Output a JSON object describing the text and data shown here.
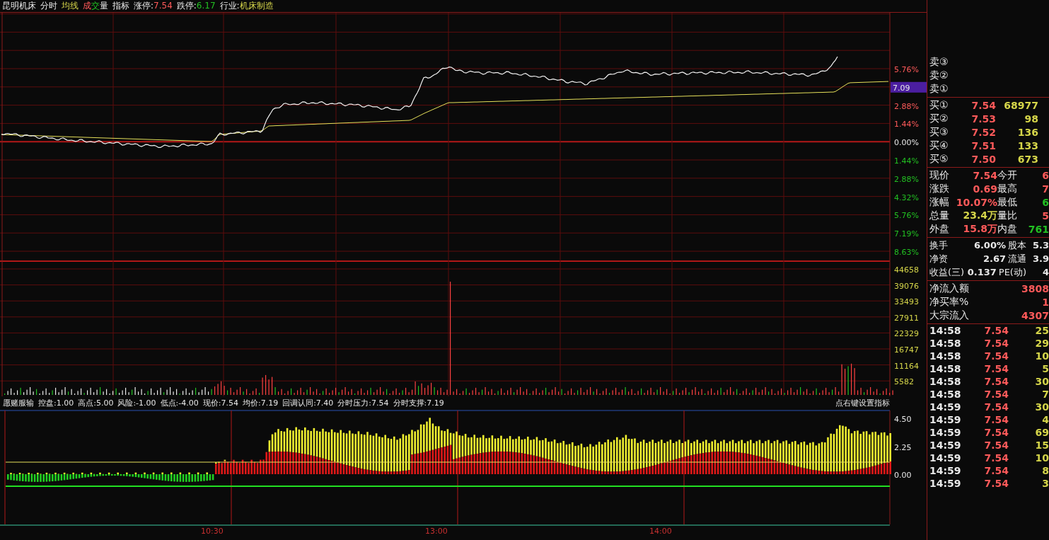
{
  "top_bar": [
    {
      "segments": [
        {
          "text": "昆明机床",
          "kind": "plain"
        }
      ]
    },
    {
      "segments": [
        {
          "text": "分时",
          "kind": "plain"
        }
      ]
    },
    {
      "segments": [
        {
          "text": "均线",
          "kind": "vol"
        }
      ]
    },
    {
      "segments": [
        {
          "text": "成",
          "kind": "up"
        },
        {
          "text": "交",
          "kind": "down"
        },
        {
          "text": "量",
          "kind": "plain"
        }
      ]
    },
    {
      "segments": [
        {
          "text": "指标",
          "kind": "plain"
        }
      ]
    },
    {
      "segments": [
        {
          "text": "涨停:",
          "kind": "plain"
        },
        {
          "text": "7.54",
          "kind": "up"
        }
      ]
    },
    {
      "segments": [
        {
          "text": "跌停:",
          "kind": "plain"
        },
        {
          "text": "6.17",
          "kind": "down"
        }
      ]
    },
    {
      "segments": [
        {
          "text": "行业:",
          "kind": "plain"
        },
        {
          "text": "机床制造",
          "kind": "vol"
        }
      ]
    }
  ],
  "price_axis": [
    {
      "label": "5.76%",
      "kind": "up"
    },
    {
      "kind": "tag"
    },
    {
      "label": "2.88%",
      "kind": "up"
    },
    {
      "label": "1.44%",
      "kind": "up"
    },
    {
      "label": "0.00%",
      "kind": "plain"
    },
    {
      "label": "1.44%",
      "kind": "down"
    },
    {
      "label": "2.88%",
      "kind": "down"
    },
    {
      "label": "4.32%",
      "kind": "down"
    },
    {
      "label": "5.76%",
      "kind": "down"
    },
    {
      "label": "7.19%",
      "kind": "down"
    },
    {
      "label": "8.63%",
      "kind": "down"
    }
  ],
  "price_tag": "7.09",
  "volume_axis": [
    "44658",
    "39076",
    "33493",
    "27911",
    "22329",
    "16747",
    "11164",
    "5582"
  ],
  "indicator": {
    "name": "愿赌服输",
    "params": [
      "控盘:1.00",
      "高点:5.00",
      "风险:-1.00",
      "低点:-4.00",
      "现价:7.54",
      "均价:7.19",
      "回调认同:7.40",
      "分时压力:7.54",
      "分时支撑:7.19"
    ],
    "hint": "点右键设置指标",
    "axis": [
      "4.50",
      "2.25",
      "0.00"
    ]
  },
  "time_axis": [
    "10:30",
    "13:00",
    "14:00"
  ],
  "sell": [
    "卖③",
    "卖②",
    "卖①"
  ],
  "buy": [
    {
      "label": "买①",
      "price": "7.54",
      "volume": "68977"
    },
    {
      "label": "买②",
      "price": "7.53",
      "volume": "98"
    },
    {
      "label": "买③",
      "price": "7.52",
      "volume": "136"
    },
    {
      "label": "买④",
      "price": "7.51",
      "volume": "133"
    },
    {
      "label": "买⑤",
      "price": "7.50",
      "volume": "673"
    }
  ],
  "quote": [
    [
      {
        "label": "现价",
        "value": "7.54",
        "kind": "up"
      },
      {
        "label": "今开",
        "value": "6",
        "kind": "up"
      }
    ],
    [
      {
        "label": "涨跌",
        "value": "0.69",
        "kind": "up"
      },
      {
        "label": "最高",
        "value": "7",
        "kind": "up"
      }
    ],
    [
      {
        "label": "涨幅",
        "value": "10.07%",
        "kind": "up"
      },
      {
        "label": "最低",
        "value": "6",
        "kind": "down"
      }
    ],
    [
      {
        "label": "总量",
        "value": "23.4万",
        "kind": "vol"
      },
      {
        "label": "量比",
        "value": "5",
        "kind": "up"
      }
    ],
    [
      {
        "label": "外盘",
        "value": "15.8万",
        "kind": "up"
      },
      {
        "label": "内盘",
        "value": "761",
        "kind": "down"
      }
    ]
  ],
  "stats": [
    [
      {
        "label": "换手",
        "value": "6.00%"
      },
      {
        "label": "股本",
        "value": "5.3"
      }
    ],
    [
      {
        "label": "净资",
        "value": "2.67"
      },
      {
        "label": "流通",
        "value": "3.9"
      }
    ],
    [
      {
        "label": "收益(三)",
        "value": "0.137"
      },
      {
        "label": "PE(动)",
        "value": "4"
      }
    ]
  ],
  "flow": [
    {
      "label": "净流入额",
      "value": "3808",
      "kind": "up"
    },
    {
      "label": "净买率%",
      "value": "1",
      "kind": "up"
    },
    {
      "label": "大宗流入",
      "value": "4307",
      "kind": "up"
    }
  ],
  "trades": [
    {
      "time": "14:58",
      "price": "7.54",
      "volume": "25"
    },
    {
      "time": "14:58",
      "price": "7.54",
      "volume": "29"
    },
    {
      "time": "14:58",
      "price": "7.54",
      "volume": "10"
    },
    {
      "time": "14:58",
      "price": "7.54",
      "volume": "5"
    },
    {
      "time": "14:58",
      "price": "7.54",
      "volume": "30"
    },
    {
      "time": "14:58",
      "price": "7.54",
      "volume": "7"
    },
    {
      "time": "14:59",
      "price": "7.54",
      "volume": "30"
    },
    {
      "time": "14:59",
      "price": "7.54",
      "volume": "4"
    },
    {
      "time": "14:59",
      "price": "7.54",
      "volume": "69"
    },
    {
      "time": "14:59",
      "price": "7.54",
      "volume": "15"
    },
    {
      "time": "14:59",
      "price": "7.54",
      "volume": "10"
    },
    {
      "time": "14:59",
      "price": "7.54",
      "volume": "8"
    },
    {
      "time": "14:59",
      "price": "7.54",
      "volume": "3"
    }
  ]
}
